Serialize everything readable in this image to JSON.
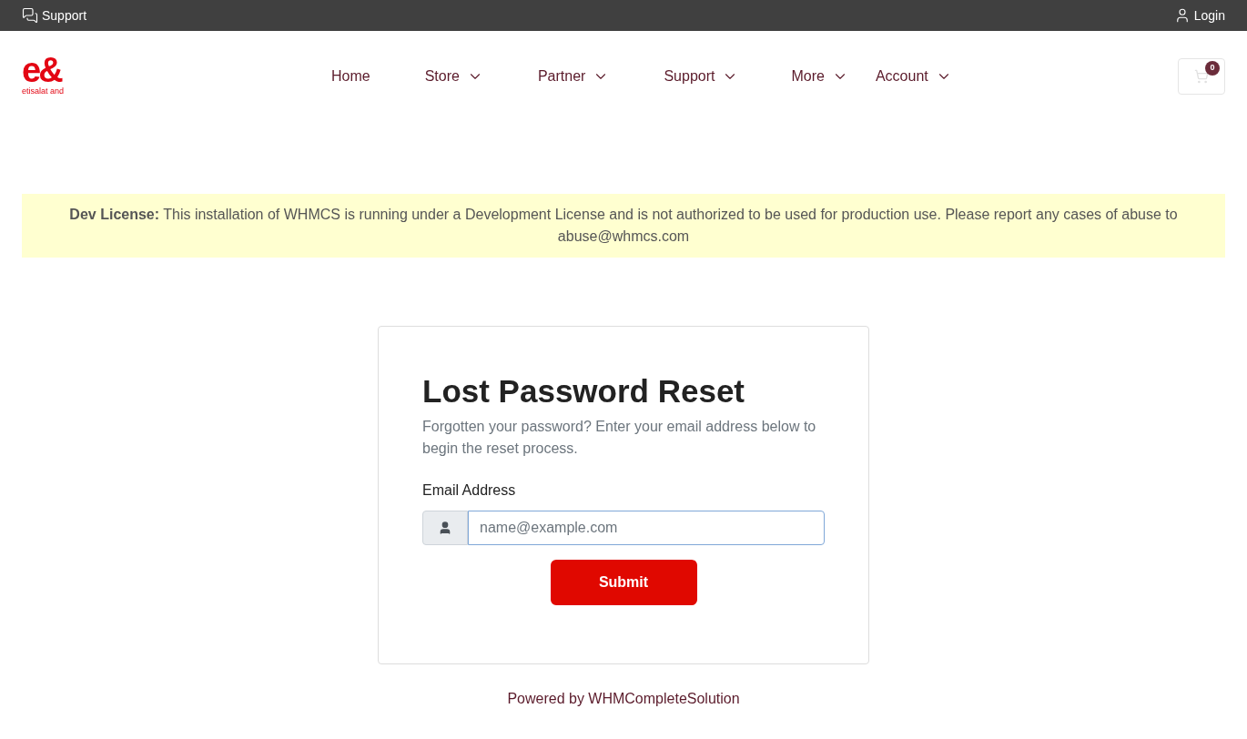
{
  "topbar": {
    "support": "Support",
    "login": "Login"
  },
  "logo": {
    "mark": "e&",
    "caption": "etisalat and"
  },
  "nav": [
    {
      "label": "Home",
      "dropdown": false
    },
    {
      "label": "Store",
      "dropdown": true
    },
    {
      "label": "Partner",
      "dropdown": true
    },
    {
      "label": "Support",
      "dropdown": true
    },
    {
      "label": "More",
      "dropdown": true
    },
    {
      "label": "Account",
      "dropdown": true
    }
  ],
  "cart": {
    "count": "0"
  },
  "notice": "**Dev License:** This installation of WHMCS is running under a Development License and is not authorized to be used for production use. Please report any cases of abuse to abuse@whmcs.com",
  "card": {
    "title": "Lost Password Reset",
    "description": "Forgotten your password? Enter your email address below to begin the reset process.",
    "field_label": "Email Address",
    "placeholder": "name@example.com",
    "submit": "Submit"
  },
  "footer": "Powered by WHMCompleteSolution"
}
